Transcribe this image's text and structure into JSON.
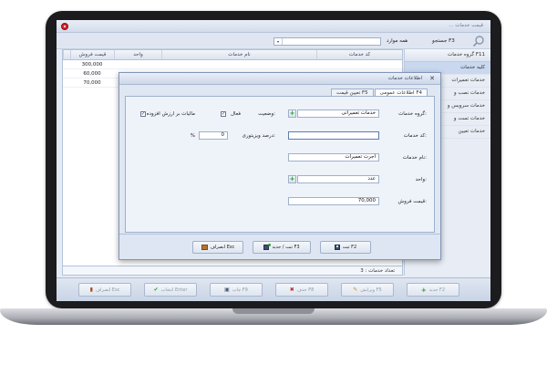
{
  "window": {
    "title": "... قیمت خدمات"
  },
  "search": {
    "label": "جستجو F3",
    "scope": "همه موارد"
  },
  "side_panel": {
    "header": "گروه خدمات F11",
    "items": [
      "کلیه خدمات",
      "خدمات تعمیرات",
      "خدمات نصب و",
      "خدمات سرویس و",
      "خدمات تست و",
      "خدمات تعیین"
    ]
  },
  "grid": {
    "columns": [
      "قیمت فروش",
      "واحد",
      "نام خدمات",
      "کد خدمات"
    ],
    "rows": [
      {
        "price": "300,000"
      },
      {
        "price": "60,000"
      },
      {
        "price": "70,000"
      }
    ],
    "footer": "تعداد خدمات : 3"
  },
  "toolbar": {
    "new": "جدید F2",
    "edit": "ویرایش F5",
    "delete": "حذف F8",
    "print": "چاپ F9",
    "select": "انتخاب Enter",
    "exit": "انصراف Esc"
  },
  "dialog": {
    "title": "اطلاعات خدمات",
    "tabs": [
      "اطلاعات عمومی F4",
      "تعیین قیمت F5"
    ],
    "fields": {
      "group_label": "گروه خدمات:",
      "group_value": "خدمات تعمیراتی",
      "code_label": "کد خدمات:",
      "code_value": "",
      "name_label": "نام خدمات:",
      "name_value": "اجرت تعمیرات",
      "unit_label": "واحد:",
      "unit_value": "عدد",
      "price_label": "قیمت فروش:",
      "price_value": "70,000",
      "status_label": "وضعیت:",
      "active_label": "فعال",
      "vat_label": "مالیات بر ارزش افزوده",
      "discount_label": "درصد ویزیتوری:",
      "discount_value": "0",
      "percent_sign": "%"
    },
    "buttons": {
      "save": "ثبت F2",
      "save_new": "ثبت / جدید F3",
      "cancel": "انصراف Esc"
    }
  },
  "colors": {
    "accent": "#2e9b2e",
    "frame": "#1c1c1e",
    "dialog_bg": "#dfe7f3"
  }
}
